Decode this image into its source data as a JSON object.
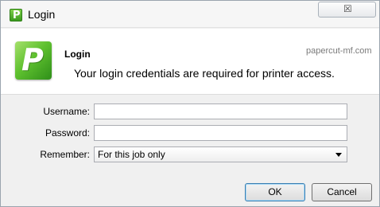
{
  "window": {
    "title": "Login",
    "close_glyph": "☒",
    "title_icon": "papercut-logo-icon"
  },
  "banner": {
    "heading": "Login",
    "site": "papercut-mf.com",
    "message": "Your login credentials are required for printer access.",
    "logo_letter": "P",
    "logo_icon": "papercut-logo-icon"
  },
  "form": {
    "username_label": "Username:",
    "username_value": "",
    "password_label": "Password:",
    "password_value": "",
    "remember_label": "Remember:",
    "remember_selected": "For this job only"
  },
  "buttons": {
    "ok": "OK",
    "cancel": "Cancel"
  },
  "colors": {
    "accent_green": "#5fc12f",
    "window_bg": "#f0f0f0",
    "banner_bg": "#ffffff"
  }
}
